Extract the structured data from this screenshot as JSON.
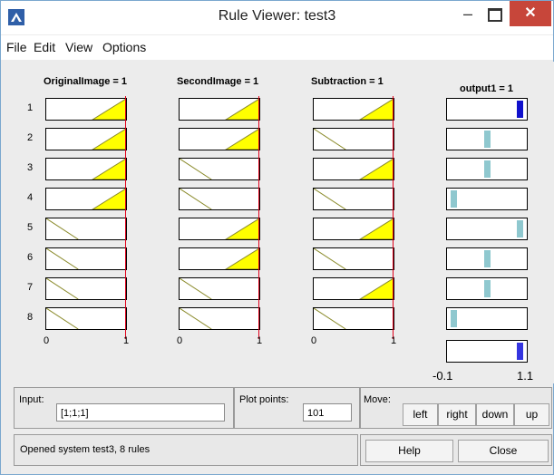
{
  "window": {
    "title": "Rule Viewer: test3",
    "minimize_glyph": "–",
    "close_glyph": "✕"
  },
  "menu": [
    "File",
    "Edit",
    "View",
    "Options"
  ],
  "inputs": [
    {
      "header": "OriginalImage = 1",
      "min": "0",
      "max": "1",
      "rules": [
        "fired",
        "fired",
        "fired",
        "fired",
        "not",
        "not",
        "not",
        "not"
      ]
    },
    {
      "header": "SecondImage = 1",
      "min": "0",
      "max": "1",
      "rules": [
        "fired",
        "fired",
        "not",
        "not",
        "fired",
        "fired",
        "not",
        "not"
      ]
    },
    {
      "header": "Subtraction = 1",
      "min": "0",
      "max": "1",
      "rules": [
        "fired",
        "not",
        "fired",
        "not",
        "fired",
        "not",
        "fired",
        "not"
      ]
    }
  ],
  "output": {
    "header": "output1 = 1",
    "min": "-0.1",
    "max": "1.1",
    "rule_bars": [
      {
        "level": 1.0,
        "color": "#1010cc"
      },
      {
        "level": 0.5,
        "color": "#8fc8cf"
      },
      {
        "level": 0.5,
        "color": "#8fc8cf"
      },
      {
        "level": 0.0,
        "color": "#8fc8cf"
      },
      {
        "level": 1.0,
        "color": "#8fc8cf"
      },
      {
        "level": 0.5,
        "color": "#8fc8cf"
      },
      {
        "level": 0.5,
        "color": "#8fc8cf"
      },
      {
        "level": 0.0,
        "color": "#8fc8cf"
      }
    ],
    "aggregate": {
      "level": 1.0,
      "color": "#3535e0"
    }
  },
  "rule_numbers": [
    "1",
    "2",
    "3",
    "4",
    "5",
    "6",
    "7",
    "8"
  ],
  "controls": {
    "input_label": "Input:",
    "input_value": "[1;1;1]",
    "plot_points_label": "Plot points:",
    "plot_points_value": "101",
    "move_label": "Move:",
    "left": "left",
    "right": "right",
    "down": "down",
    "up": "up",
    "help": "Help",
    "close": "Close",
    "status": "Opened system test3, 8 rules"
  },
  "colors": {
    "fill": "#ffff00",
    "line": "#8a8a2a",
    "index_line": "#e0001a"
  }
}
